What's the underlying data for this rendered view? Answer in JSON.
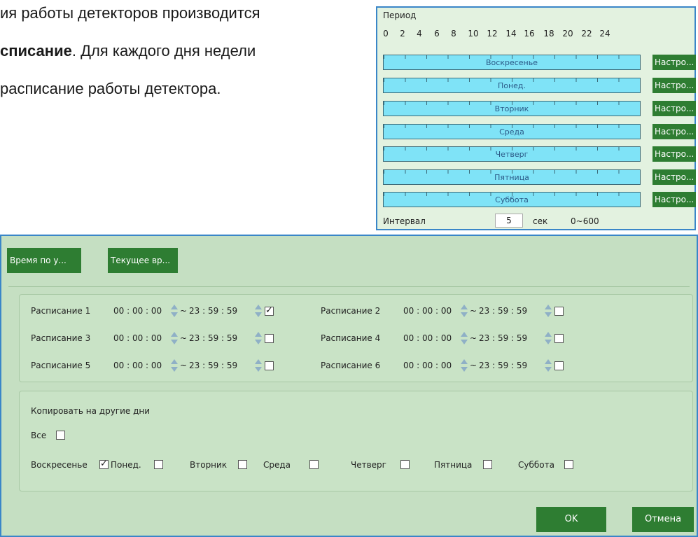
{
  "document": {
    "line1": "ия работы детекторов производится",
    "line2_bold": "списание",
    "line2_rest": ". Для каждого дня недели",
    "line3": "расписание работы детектора."
  },
  "period_panel": {
    "title": "Период",
    "ticks": [
      "0",
      "2",
      "4",
      "6",
      "8",
      "10",
      "12",
      "14",
      "16",
      "18",
      "20",
      "22",
      "24"
    ],
    "days": [
      "Воскресенье",
      "Понед.",
      "Вторник",
      "Среда",
      "Четверг",
      "Пятница",
      "Суббота"
    ],
    "settings_label": "Настро...",
    "interval_label": "Интервал",
    "interval_value": "5",
    "interval_unit": "сек",
    "interval_range": "0~600",
    "bar_color": "#7fe3f7",
    "button_color": "#2e7d32"
  },
  "dialog": {
    "btn_time_by": "Время по у...",
    "btn_current_time": "Текущее вр...",
    "schedules": [
      {
        "label": "Расписание 1",
        "start": "00 : 00 : 00",
        "sep": "~",
        "end": "23 : 59 : 59",
        "checked": true
      },
      {
        "label": "Расписание 2",
        "start": "00 : 00 : 00",
        "sep": "~",
        "end": "23 : 59 : 59",
        "checked": false
      },
      {
        "label": "Расписание 3",
        "start": "00 : 00 : 00",
        "sep": "~",
        "end": "23 : 59 : 59",
        "checked": false
      },
      {
        "label": "Расписание 4",
        "start": "00 : 00 : 00",
        "sep": "~",
        "end": "23 : 59 : 59",
        "checked": false
      },
      {
        "label": "Расписание 5",
        "start": "00 : 00 : 00",
        "sep": "~",
        "end": "23 : 59 : 59",
        "checked": false
      },
      {
        "label": "Расписание 6",
        "start": "00 : 00 : 00",
        "sep": "~",
        "end": "23 : 59 : 59",
        "checked": false
      }
    ],
    "copy_title": "Копировать на другие дни",
    "all_label": "Все",
    "days": [
      {
        "label": "Воскресенье",
        "checked": true
      },
      {
        "label": "Понед.",
        "checked": false
      },
      {
        "label": "Вторник",
        "checked": false
      },
      {
        "label": "Среда",
        "checked": false
      },
      {
        "label": "Четверг",
        "checked": false
      },
      {
        "label": "Пятница",
        "checked": false
      },
      {
        "label": "Суббота",
        "checked": false
      }
    ],
    "ok_label": "OK",
    "cancel_label": "Отмена"
  }
}
